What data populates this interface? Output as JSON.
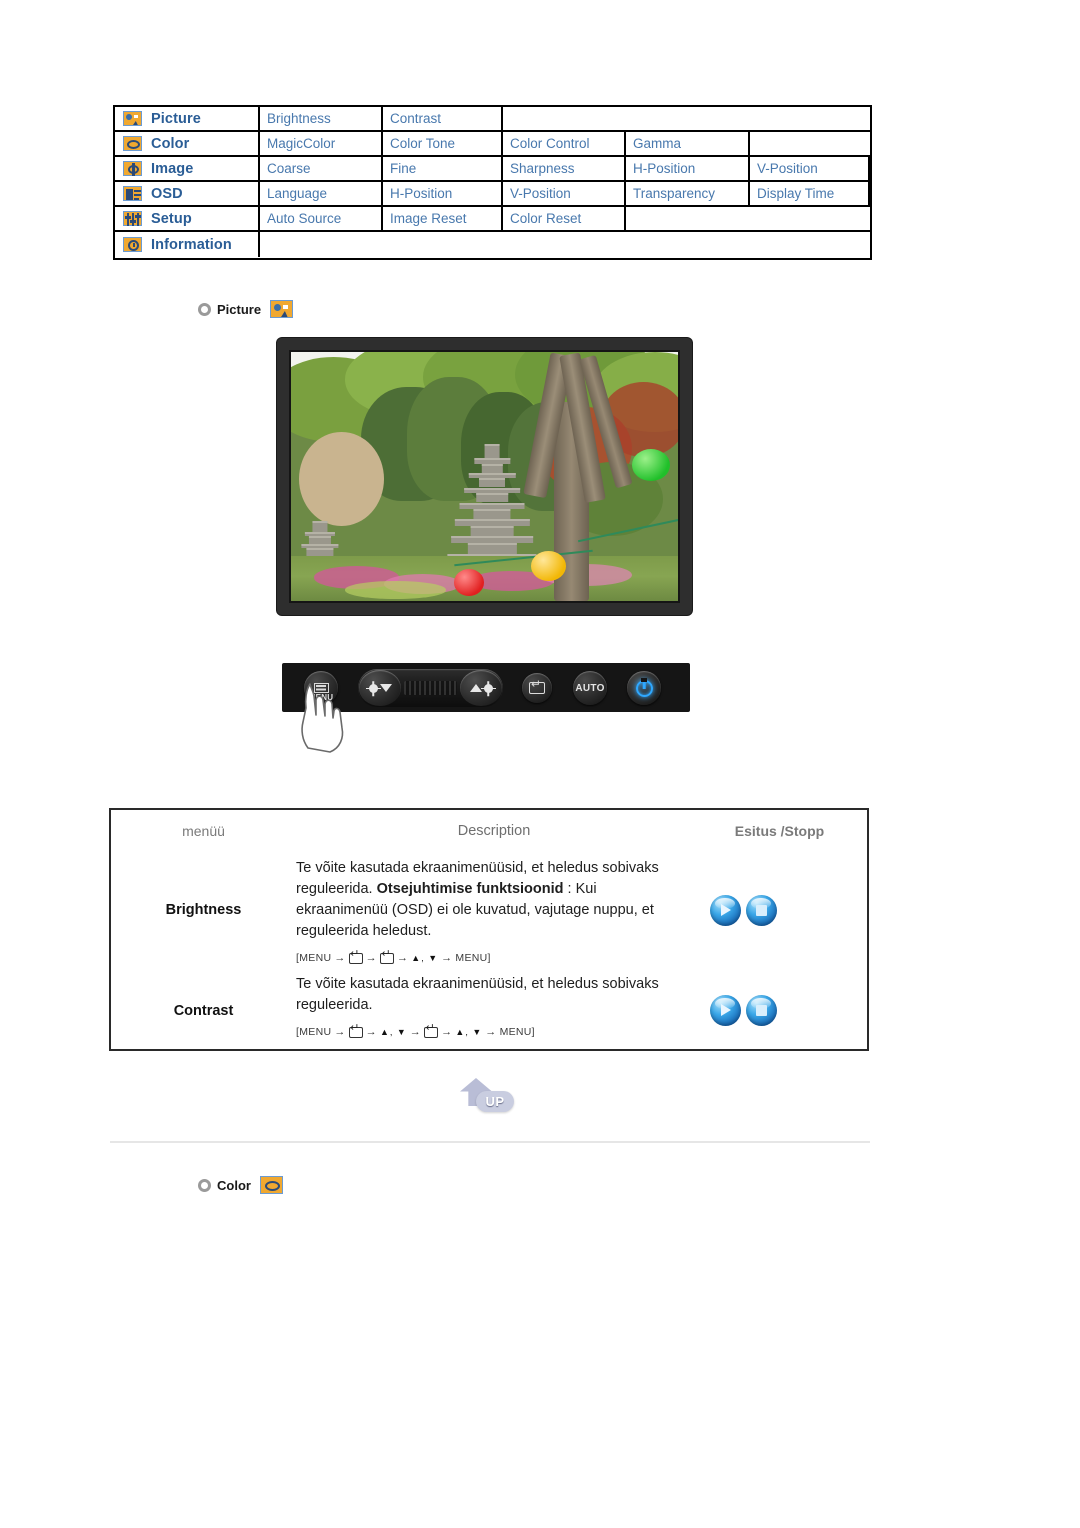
{
  "osd_menu_map": {
    "rows": [
      {
        "icon": "picture-icon",
        "category": "Picture",
        "items": [
          "Brightness",
          "Contrast"
        ]
      },
      {
        "icon": "color-icon",
        "category": "Color",
        "items": [
          "MagicColor",
          "Color Tone",
          "Color Control",
          "Gamma"
        ]
      },
      {
        "icon": "image-icon",
        "category": "Image",
        "items": [
          "Coarse",
          "Fine",
          "Sharpness",
          "H-Position",
          "V-Position"
        ]
      },
      {
        "icon": "osd-icon",
        "category": "OSD",
        "items": [
          "Language",
          "H-Position",
          "V-Position",
          "Transparency",
          "Display Time"
        ]
      },
      {
        "icon": "setup-icon",
        "category": "Setup",
        "items": [
          "Auto Source",
          "Image Reset",
          "Color Reset"
        ]
      },
      {
        "icon": "info-icon",
        "category": "Information",
        "items": []
      }
    ]
  },
  "sections": {
    "picture": {
      "title": "Picture",
      "icon": "picture-icon",
      "bullet": "ring-bullet"
    },
    "color": {
      "title": "Color",
      "icon": "color-icon",
      "bullet": "ring-bullet"
    }
  },
  "monitor_preview": {
    "alt": "Korean garden photograph displayed on monitor screen with stone pagoda, trees and paper lanterns"
  },
  "button_panel": {
    "buttons": [
      {
        "name": "menu-button",
        "label": "MENU"
      },
      {
        "name": "down-button",
        "label": ""
      },
      {
        "name": "up-brightness-button",
        "label": ""
      },
      {
        "name": "enter-button",
        "label": ""
      },
      {
        "name": "auto-button",
        "label": "AUTO"
      },
      {
        "name": "power-button",
        "label": ""
      }
    ]
  },
  "description_table": {
    "headers": {
      "menu": "menüü",
      "description": "Description",
      "play": "Esitus /Stopp"
    },
    "rows": [
      {
        "menu": "Brightness",
        "line1": "Te võite kasutada ekraanimenüüsid, et heledus sobivaks",
        "line2": "reguleerida.",
        "bold_lead": "Otsejuhtimise funktsioonid",
        "line3": " : Kui ekraanimenüü (OSD) ei",
        "line4": "ole kuvatud, vajutage nuppu, et reguleerida heledust.",
        "sequence": [
          "[MENU",
          "→",
          "ENTER",
          "→",
          "ENTER",
          "→",
          "▲, ▼",
          "→",
          "MENU]"
        ],
        "sequence_text": "[MENU → ↵ → ↵ → ▲, ▼ → MENU]",
        "icons": [
          "play-icon",
          "stop-icon"
        ]
      },
      {
        "menu": "Contrast",
        "line1": "Te võite kasutada ekraanimenüüsid, et heledus sobivaks",
        "line2": "reguleerida.",
        "bold_lead": "",
        "line3": "",
        "line4": "",
        "sequence": [
          "[MENU",
          "→",
          "ENTER",
          "→",
          "▲, ▼",
          "→",
          "ENTER",
          "→",
          "▲, ▼",
          "→",
          "MENU]"
        ],
        "sequence_text": "[MENU → ↵ → ▲, ▼ → ↵ → ▲, ▼ → MENU]",
        "icons": [
          "play-icon",
          "stop-icon"
        ]
      }
    ]
  },
  "up_button": {
    "label": "UP"
  },
  "colors": {
    "menu_category_text": "#2a5d96",
    "menu_item_text": "#4878ad",
    "icon_background": "#f0a830",
    "icon_border": "#6b9bd2",
    "table_border": "#000000",
    "header_text": "#7a7a7a",
    "body_text": "#1e1e1e",
    "play_icon_blue": "#1667b5",
    "power_led_blue": "#2fa8ff",
    "divider": "#e6e6e6"
  }
}
